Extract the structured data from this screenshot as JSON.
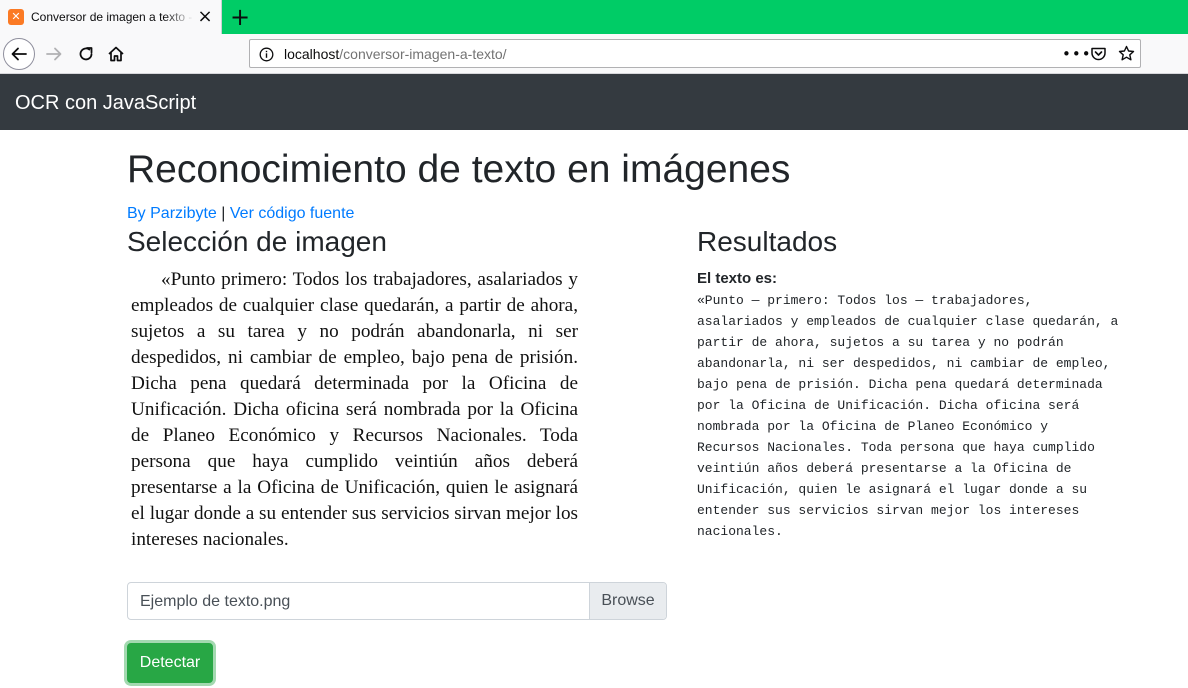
{
  "browser": {
    "tab": {
      "title": "Conversor de imagen a texto - Parzibyte",
      "close": "×"
    },
    "new_tab": "+",
    "url": {
      "host": "localhost",
      "path": "/conversor-imagen-a-texto/"
    },
    "more": "•••",
    "icons": [
      "back-icon",
      "forward-icon",
      "reload-icon",
      "home-icon",
      "info-icon",
      "pocket-icon",
      "star-icon"
    ]
  },
  "site": {
    "brand": "OCR con JavaScript"
  },
  "header": {
    "title": "Reconocimiento de texto en imágenes",
    "author_link": "By Parzibyte",
    "separator": "|",
    "source_link": "Ver código fuente"
  },
  "left": {
    "heading": "Selección de imagen",
    "image_text": "«Punto primero: Todos los trabajadores, asalariados y empleados de cualquier clase quedarán, a partir de ahora, sujetos a su tarea y no podrán abandonarla, ni ser despedidos, ni cambiar de empleo, bajo pena de prisión. Dicha pena quedará determinada por la Oficina de Unificación. Dicha oficina será nombrada por la Oficina de Planeo Económico y Recursos Nacionales. Toda persona que haya cumplido veintiún años deberá presentarse a la Oficina de Unificación, quien le asignará el lugar donde a su entender sus servicios sirvan mejor los intereses nacionales.",
    "file_name": "Ejemplo de texto.png",
    "browse_label": "Browse",
    "detect_label": "Detectar"
  },
  "right": {
    "heading": "Resultados",
    "label": "El texto es:",
    "result": "«Punto — primero: Todos los — trabajadores,\nasalariados y empleados de cualquier clase quedarán, a\npartir de ahora, sujetos a su tarea y no podrán\nabandonarla, ni ser despedidos, ni cambiar de empleo,\nbajo pena de prisión. Dicha pena quedará determinada\npor la Oficina de Unificación. Dicha oficina será\nnombrada por la Oficina de Planeo Económico y\nRecursos Nacionales. Toda persona que haya cumplido\nveintiún años deberá presentarse a la Oficina de\nUnificación, quien le asignará el lugar donde a su\nentender sus servicios sirvan mejor los intereses\nnacionales."
  },
  "colors": {
    "tabbar": "#00cc66",
    "navbar": "#343a40",
    "link": "#007bff",
    "success": "#28a745"
  }
}
